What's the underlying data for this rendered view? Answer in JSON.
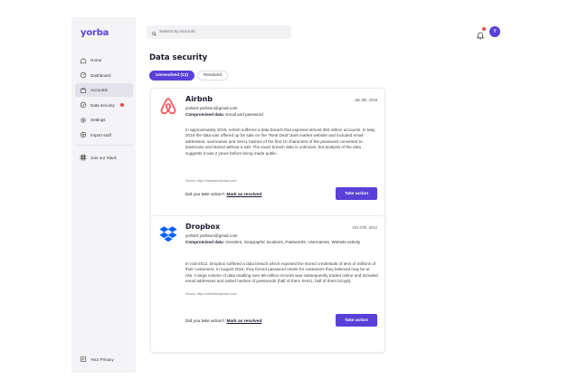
{
  "app": {
    "logo": "yorba"
  },
  "search": {
    "placeholder": "Search by account"
  },
  "header": {
    "avatar_initial": "Y"
  },
  "sidebar": {
    "items": [
      {
        "label": "Home",
        "icon": "home-icon"
      },
      {
        "label": "Dashboard",
        "icon": "dashboard-icon"
      },
      {
        "label": "Accounts",
        "icon": "accounts-icon"
      },
      {
        "label": "Data security",
        "icon": "shield-icon"
      },
      {
        "label": "Settings",
        "icon": "gear-icon"
      },
      {
        "label": "Import stuff",
        "icon": "import-icon"
      },
      {
        "label": "Join our Slack",
        "icon": "slack-icon"
      }
    ],
    "privacy": "Your Privacy"
  },
  "main": {
    "title": "Data security",
    "tabs": [
      {
        "label": "Unresolved (12)"
      },
      {
        "label": "Resolved"
      }
    ]
  },
  "breaches": [
    {
      "title": "Airbnb",
      "date": "Jan 6th, 2018",
      "email": "yorbert.yorbson@gmail.com",
      "compromised_label": "Compromised data:",
      "compromised": "Email and password",
      "description": "In approximately 2018, Airbnb suffered a data breach that exposed almost 360 million accounts. In May 2016 the data was offered up for sale on the \"Real Deal\" dark market website and included email addresses, usernames and SHA1 hashes of the first 10 characters of the password converted to lowercase and stored without a salt. The exact breach date is unknown, but analysis of the data suggests it was 2 years before being made public.",
      "source": "Source: https://haveibeenpwned.com/",
      "action_q": "Did you take action?",
      "resolve": "Mark as resolved",
      "button": "Take action"
    },
    {
      "title": "Dropbox",
      "date": "Oct 27th, 2012",
      "email": "yorbert.yorbson@gmail.com",
      "compromised_label": "Compromised data:",
      "compromised": "Genders, Geographic locations, Passwords, Usernames, Website activity",
      "description": "In mid-2012, Dropbox suffered a data breach which exposed the stored credentials of tens of millions of their customers. In August 2016, they forced password resets for customers they believed may be at risk. A large volume of data totalling over 68 million records was subsequently traded online and included email addresses and salted hashes of passwords (half of them SHA1, half of them bcrypt).",
      "source": "Source: https://haveibeenpwned.com/",
      "action_q": "Did you take action?",
      "resolve": "Mark as resolved",
      "button": "Take action"
    }
  ],
  "colors": {
    "accent": "#5a3fd9",
    "airbnb": "#ff5a5f",
    "dropbox": "#0061fe",
    "alert": "#e5484d"
  }
}
